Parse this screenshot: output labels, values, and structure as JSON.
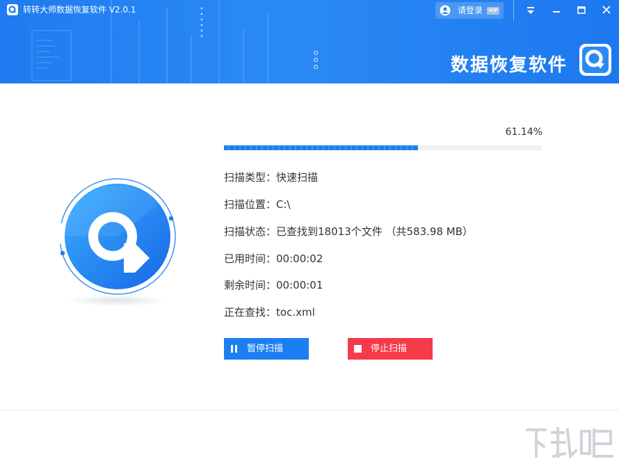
{
  "window": {
    "title": "转转大师数据恢复软件 V2.0.1",
    "login_label": "请登录",
    "vip_badge": "VIP",
    "brand_text": "数据恢复软件",
    "icons": [
      "app-logo-icon",
      "user-icon",
      "dropdown-menu-icon",
      "minimize-icon",
      "maximize-icon",
      "close-icon"
    ]
  },
  "scan": {
    "percent_text": "61.14%",
    "progress_value": 0.6114,
    "rows": [
      {
        "label": "扫描类型：",
        "value": "快速扫描"
      },
      {
        "label": "扫描位置：",
        "value": "C:\\"
      },
      {
        "label": "扫描状态：",
        "value": "已查找到18013个文件 （共583.98 MB）"
      },
      {
        "label": "已用时间：",
        "value": "00:00:02"
      },
      {
        "label": "剩余时间：",
        "value": "00:00:01"
      },
      {
        "label": "正在查找：",
        "value": "toc.xml"
      }
    ]
  },
  "buttons": {
    "pause_label": "暂停扫描",
    "stop_label": "停止扫描"
  },
  "colors": {
    "header_blue": "#1f7cf0",
    "progress_blue": "#1e7ff0",
    "stop_red": "#f53a49"
  }
}
